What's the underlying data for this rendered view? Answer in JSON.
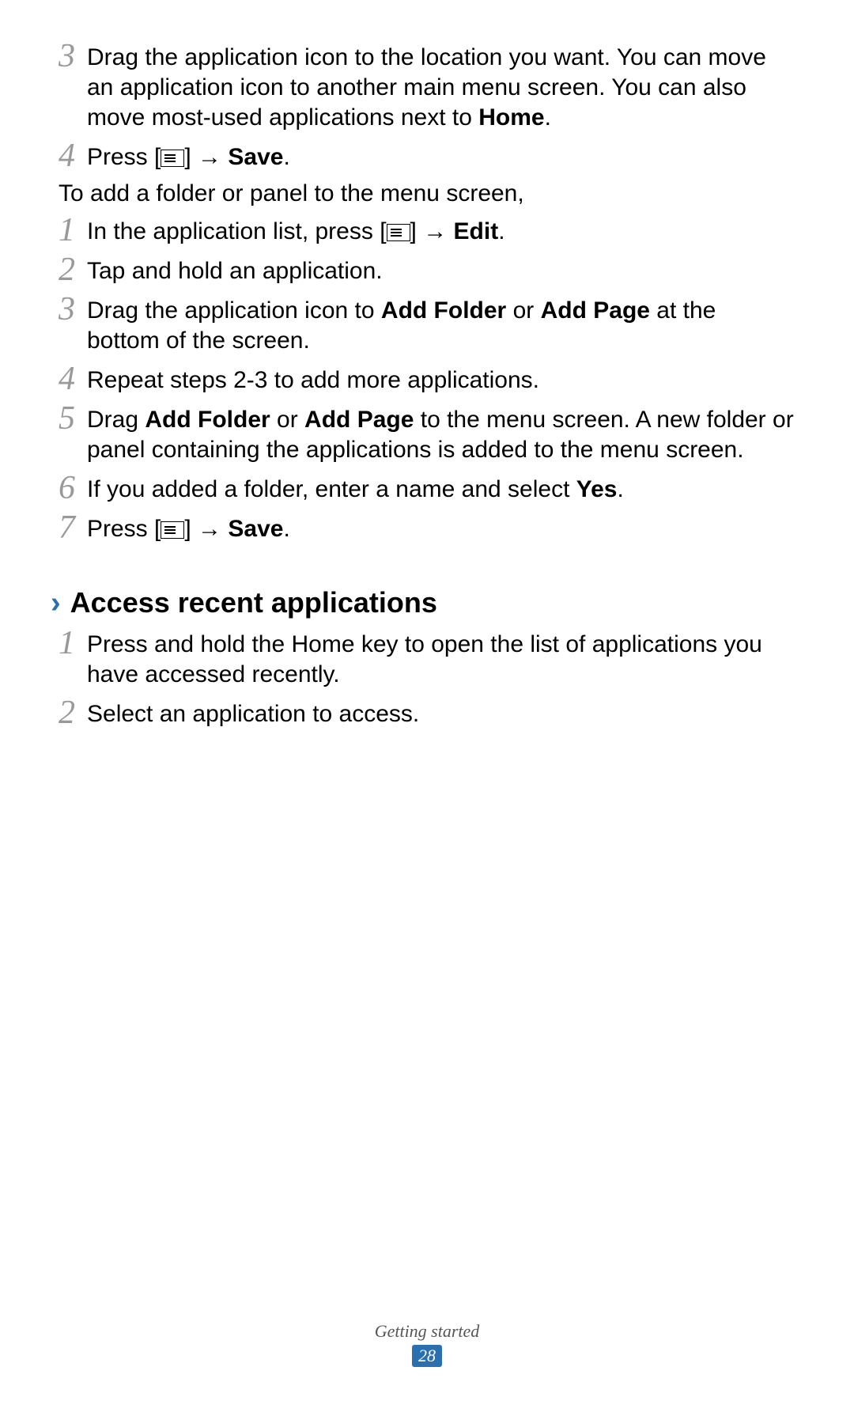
{
  "listA": {
    "3": {
      "num": "3",
      "parts": [
        {
          "t": "Drag the application icon to the location you want. You can move an application icon to another main menu screen. You can also move most-used applications next to "
        },
        {
          "t": "Home",
          "bold": true
        },
        {
          "t": "."
        }
      ]
    },
    "4": {
      "num": "4",
      "parts": [
        {
          "t": "Press ["
        },
        {
          "icon": "menu"
        },
        {
          "t": "] → "
        },
        {
          "t": "Save",
          "bold": true
        },
        {
          "t": "."
        }
      ]
    }
  },
  "plain1": "To add a folder or panel to the menu screen,",
  "listB": {
    "1": {
      "num": "1",
      "parts": [
        {
          "t": "In the application list, press ["
        },
        {
          "icon": "menu"
        },
        {
          "t": "] → "
        },
        {
          "t": "Edit",
          "bold": true
        },
        {
          "t": "."
        }
      ]
    },
    "2": {
      "num": "2",
      "parts": [
        {
          "t": "Tap and hold an application."
        }
      ]
    },
    "3": {
      "num": "3",
      "parts": [
        {
          "t": "Drag the application icon to "
        },
        {
          "t": "Add Folder",
          "bold": true
        },
        {
          "t": " or "
        },
        {
          "t": "Add Page",
          "bold": true
        },
        {
          "t": " at the bottom of the screen."
        }
      ]
    },
    "4": {
      "num": "4",
      "parts": [
        {
          "t": "Repeat steps 2-3 to add more applications."
        }
      ]
    },
    "5": {
      "num": "5",
      "parts": [
        {
          "t": "Drag "
        },
        {
          "t": "Add Folder",
          "bold": true
        },
        {
          "t": " or "
        },
        {
          "t": "Add Page",
          "bold": true
        },
        {
          "t": " to the menu screen. A new folder or panel containing the applications is added to the menu screen."
        }
      ]
    },
    "6": {
      "num": "6",
      "parts": [
        {
          "t": "If you added a folder, enter a name and select "
        },
        {
          "t": "Yes",
          "bold": true
        },
        {
          "t": "."
        }
      ]
    },
    "7": {
      "num": "7",
      "parts": [
        {
          "t": "Press ["
        },
        {
          "icon": "menu"
        },
        {
          "t": "] → "
        },
        {
          "t": "Save",
          "bold": true
        },
        {
          "t": "."
        }
      ]
    }
  },
  "section": {
    "chevron": "›",
    "title": "Access recent applications"
  },
  "listC": {
    "1": {
      "num": "1",
      "parts": [
        {
          "t": "Press and hold the Home key to open the list of applications you have accessed recently."
        }
      ]
    },
    "2": {
      "num": "2",
      "parts": [
        {
          "t": "Select an application to access."
        }
      ]
    }
  },
  "footer": {
    "label": "Getting started",
    "page": "28"
  }
}
